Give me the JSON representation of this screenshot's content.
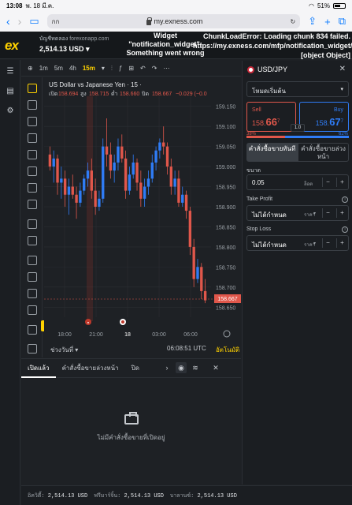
{
  "status_bar": {
    "time": "13:08",
    "date": "พ. 18 มี.ค.",
    "wifi": "wifi-icon",
    "battery_pct": "51%"
  },
  "browser": {
    "tab_prefix": "กก",
    "host": "my.exness.com"
  },
  "header": {
    "account_label": "บัญชีทดลอง",
    "account_server": "forexonapp.com",
    "balance": "2,514.13 USD",
    "error_widget": "Widget \"notification_widget\": Something went wrong",
    "error_chunk": "ChunkLoadError: Loading chunk 834 failed. https://my.exness.com/mfp/notification_widget/ [object Object]"
  },
  "chart_toolbar": {
    "tf_1m": "1m",
    "tf_5m": "5m",
    "tf_4h": "4h",
    "tf_15m": "15m"
  },
  "chart": {
    "legend_title": "US Dollar vs Japanese Yen · 15 ·",
    "o_label": "เปิด",
    "o_val": "158.694",
    "h_label": "สูง",
    "h_val": "158.715",
    "l_label": "ต่ำ",
    "l_val": "158.660",
    "c_label": "ปิด",
    "c_val": "158.667",
    "change": "−0.029 (−0.0",
    "price_tag": "158.667",
    "range_label": "ช่วงวันที่ ▾",
    "clock": "06:08:51 UTC",
    "auto_label": "อัตโนมัติ",
    "date_marker": "18",
    "event_badge": "●"
  },
  "chart_data": {
    "type": "candlestick",
    "x_ticks": [
      "18:00",
      "21:00",
      "18",
      "03:00",
      "06:00"
    ],
    "y_ticks": [
      159.15,
      159.1,
      159.05,
      159.0,
      158.95,
      158.9,
      158.85,
      158.8,
      158.75,
      158.7,
      158.65
    ],
    "ylim": [
      158.625,
      159.175
    ],
    "candles": [
      [
        159.03,
        159.05,
        158.99,
        159.0
      ],
      [
        159.0,
        159.04,
        158.96,
        159.02
      ],
      [
        159.02,
        159.03,
        158.93,
        158.96
      ],
      [
        158.96,
        159.0,
        158.92,
        158.97
      ],
      [
        158.97,
        158.99,
        158.9,
        158.93
      ],
      [
        158.93,
        158.97,
        158.88,
        158.95
      ],
      [
        158.95,
        158.98,
        158.92,
        158.93
      ],
      [
        158.93,
        158.95,
        158.87,
        158.91
      ],
      [
        158.91,
        158.96,
        158.9,
        158.94
      ],
      [
        158.94,
        158.98,
        158.93,
        158.97
      ],
      [
        158.97,
        159.01,
        158.95,
        158.99
      ],
      [
        158.99,
        159.02,
        158.92,
        158.94
      ],
      [
        158.94,
        158.97,
        158.88,
        158.9
      ],
      [
        158.9,
        158.94,
        158.89,
        158.92
      ],
      [
        158.92,
        159.07,
        158.91,
        159.05
      ],
      [
        159.05,
        159.12,
        159.0,
        159.03
      ],
      [
        159.03,
        159.06,
        158.97,
        158.99
      ],
      [
        158.99,
        159.03,
        158.96,
        159.01
      ],
      [
        159.01,
        159.07,
        158.99,
        159.05
      ],
      [
        159.05,
        159.08,
        159.01,
        159.02
      ],
      [
        159.02,
        159.04,
        158.92,
        158.94
      ],
      [
        158.94,
        159.0,
        158.93,
        158.98
      ],
      [
        158.98,
        159.03,
        158.97,
        159.01
      ],
      [
        159.01,
        159.02,
        158.94,
        158.96
      ],
      [
        158.96,
        158.99,
        158.9,
        158.92
      ],
      [
        158.92,
        158.97,
        158.9,
        158.95
      ],
      [
        158.95,
        158.99,
        158.93,
        158.97
      ],
      [
        158.97,
        159.03,
        158.96,
        159.01
      ],
      [
        159.01,
        159.05,
        158.99,
        159.04
      ],
      [
        159.04,
        159.07,
        159.02,
        159.06
      ],
      [
        159.06,
        159.1,
        159.03,
        159.05
      ],
      [
        159.05,
        159.06,
        158.98,
        159.0
      ],
      [
        159.0,
        159.02,
        158.93,
        158.95
      ],
      [
        158.95,
        158.99,
        158.93,
        158.97
      ],
      [
        158.97,
        158.99,
        158.9,
        158.91
      ],
      [
        158.91,
        158.95,
        158.9,
        158.93
      ],
      [
        158.93,
        158.94,
        158.87,
        158.89
      ],
      [
        158.89,
        158.9,
        158.78,
        158.8
      ],
      [
        158.8,
        158.82,
        158.7,
        158.72
      ],
      [
        158.72,
        158.77,
        158.71,
        158.75
      ],
      [
        158.75,
        158.76,
        158.67,
        158.69
      ],
      [
        158.69,
        158.72,
        158.66,
        158.667
      ]
    ]
  },
  "sidebar_icons": [
    "menu-icon",
    "wallet-icon",
    "settings-icon"
  ],
  "bottom_panel": {
    "tab_open": "เปิดแล้ว",
    "tab_pending": "คำสั่งซื้อขายล่วงหน้า",
    "tab_closed": "ปิด",
    "empty_text": "ไม่มีคำสั่งซื้อขายที่เปิดอยู่"
  },
  "footer": {
    "equity_label": "อิควิตี้:",
    "equity_val": "2,514.13 USD",
    "free_margin_label": "ฟรีมาร์จิ้น:",
    "free_margin_val": "2,514.13 USD",
    "balance_label": "บาลานซ์:",
    "balance_val": "2,514.13 USD"
  },
  "order_panel": {
    "symbol": "USD/JPY",
    "mode": "โหมดเริ่มต้น",
    "sell_label": "Sell",
    "sell_price_small": "158.",
    "sell_price_big": "66",
    "sell_price_sup": "7",
    "buy_label": "Buy",
    "buy_price_small": "158.",
    "buy_price_big": "67",
    "buy_price_sup": "7",
    "spread": "1.0",
    "sell_pct": "38%",
    "buy_pct": "62%",
    "market_order": "คำสั่งซื้อขายทันที",
    "pending_order": "คำสั่งซื้อขายล่วงหน้า",
    "volume_label": "ขนาด",
    "volume_val": "0.05",
    "volume_unit": "ล็อต",
    "tp_label": "Take Profit",
    "tp_val": "ไม่ได้กำหนด",
    "tp_unit": "ราคา",
    "sl_label": "Stop Loss",
    "sl_val": "ไม่ได้กำหนด",
    "sl_unit": "ราคา",
    "sentiment_sell_fraction": 0.38
  }
}
